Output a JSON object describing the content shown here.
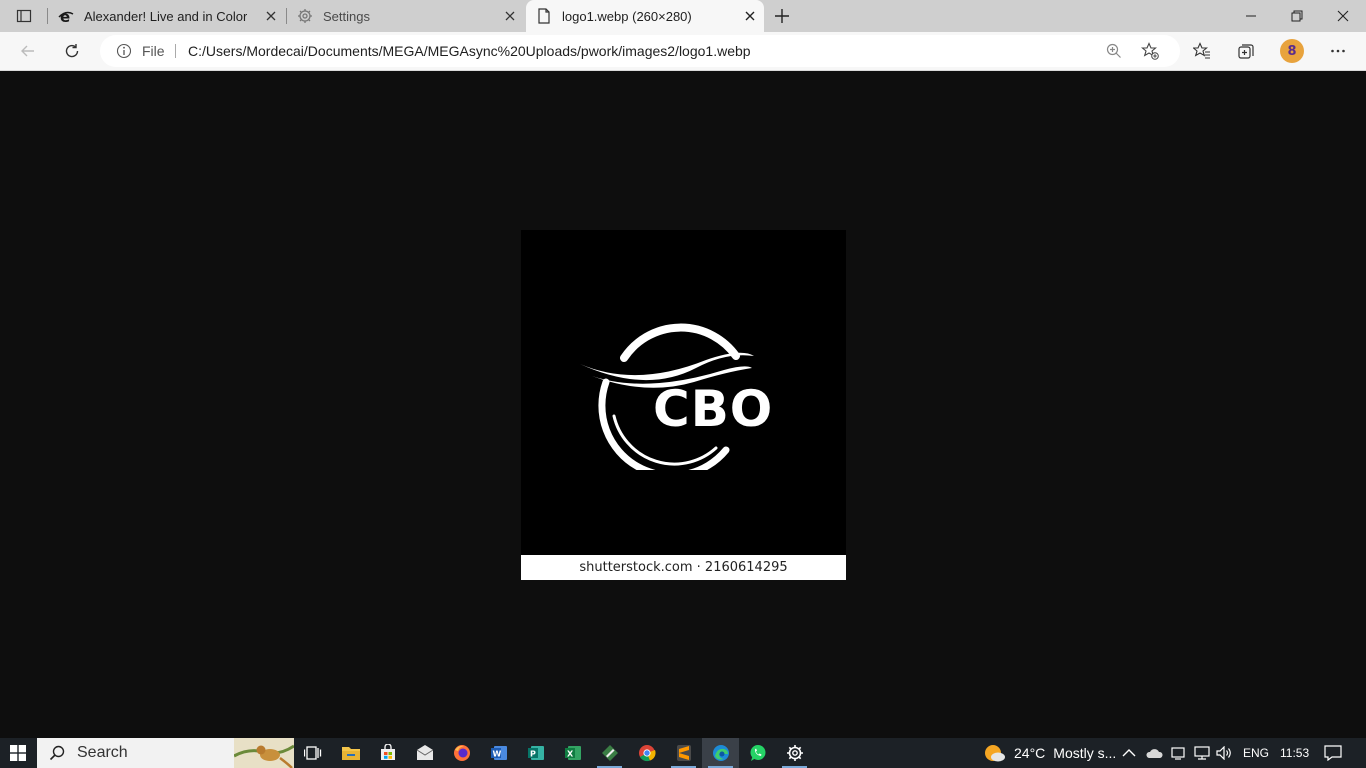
{
  "browser": {
    "tabs": [
      {
        "title": "Alexander! Live and in Color",
        "favicon": "ie-icon",
        "active": false
      },
      {
        "title": "Settings",
        "favicon": "gear-icon",
        "active": false
      },
      {
        "title": "logo1.webp (260×280)",
        "favicon": "page-icon",
        "active": true
      }
    ],
    "address": {
      "scheme_label": "File",
      "url": "C:/Users/Mordecai/Documents/MEGA/MEGAsync%20Uploads/pwork/images2/logo1.webp"
    },
    "profile_badge": "8"
  },
  "viewer": {
    "image_logo_text": "CBO",
    "image_watermark": "shutterstock.com · 2160614295"
  },
  "taskbar": {
    "search_label": "Search",
    "weather": {
      "temp": "24°C",
      "condition": "Mostly s..."
    },
    "language": "ENG",
    "time": "11:53"
  },
  "colors": {
    "tabstrip": "#cfcfcf",
    "toolbar": "#f7f7f7",
    "viewer_bg": "#0e0e0e",
    "taskbar": "#1c2126",
    "accent": "#0078d4"
  }
}
